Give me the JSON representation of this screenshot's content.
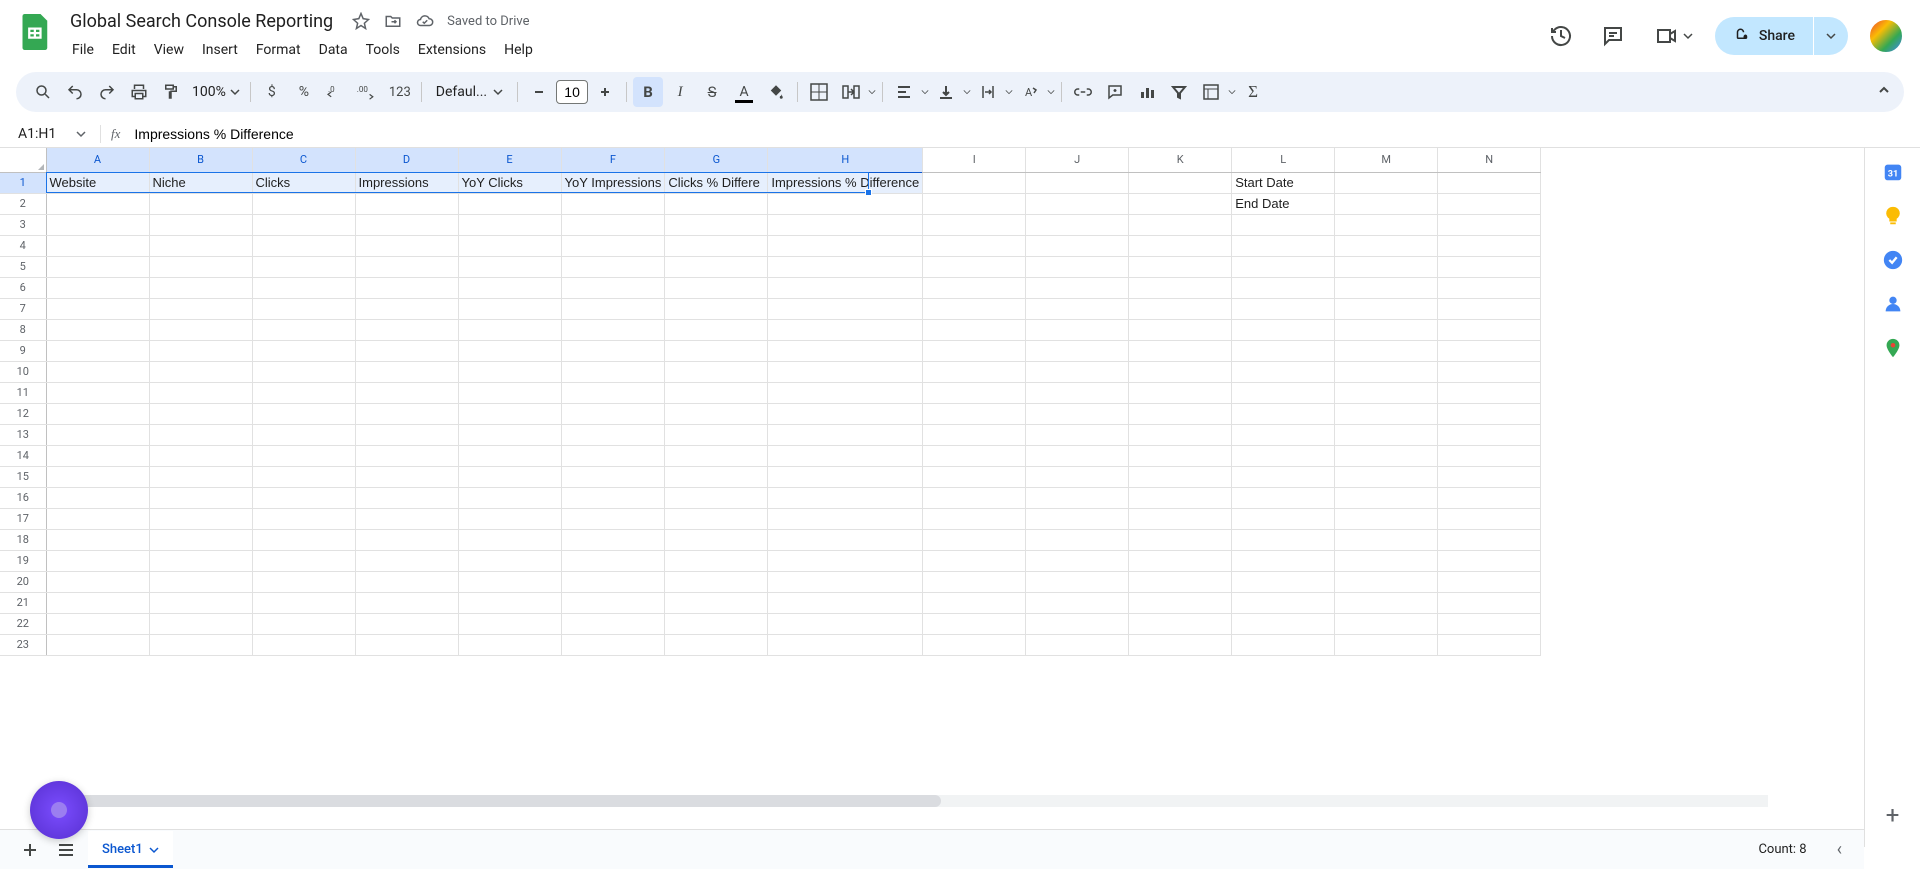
{
  "doc": {
    "title": "Global Search Console Reporting",
    "saved": "Saved to Drive"
  },
  "menus": [
    "File",
    "Edit",
    "View",
    "Insert",
    "Format",
    "Data",
    "Tools",
    "Extensions",
    "Help"
  ],
  "share_label": "Share",
  "toolbar": {
    "zoom": "100%",
    "currency": "$",
    "percent": "%",
    "num123": "123",
    "font": "Defaul...",
    "font_size": "10"
  },
  "name_box": "A1:H1",
  "formula_value": "Impressions % Difference",
  "columns": [
    "A",
    "B",
    "C",
    "D",
    "E",
    "F",
    "G",
    "H",
    "I",
    "J",
    "K",
    "L",
    "M",
    "N"
  ],
  "rows_count": 23,
  "selected_cols": [
    "A",
    "B",
    "C",
    "D",
    "E",
    "F",
    "G",
    "H"
  ],
  "selected_row": 1,
  "cells": {
    "r1": {
      "A": "Website",
      "B": "Niche",
      "C": "Clicks",
      "D": "Impressions",
      "E": "YoY Clicks",
      "F": "YoY Impressions",
      "G": "Clicks % Differe",
      "H": "Impressions % Difference",
      "L": "Start Date"
    },
    "r2": {
      "L": "End Date"
    }
  },
  "col_widths": {
    "A": 103,
    "B": 103,
    "C": 103,
    "D": 103,
    "E": 103,
    "F": 103,
    "G": 103,
    "H": 103,
    "I": 103,
    "J": 103,
    "K": 103,
    "L": 103,
    "M": 103,
    "N": 103
  },
  "sheet_tab": "Sheet1",
  "status": "Count: 8",
  "side_icons": [
    "calendar",
    "keep",
    "tasks",
    "contacts",
    "maps"
  ]
}
